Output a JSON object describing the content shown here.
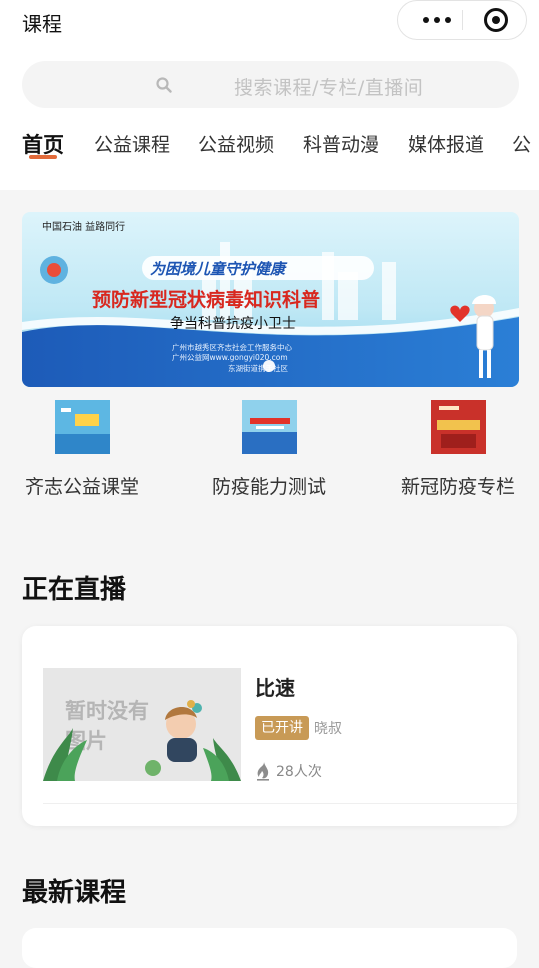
{
  "header": {
    "title": "课程"
  },
  "capsule": {
    "more_icon": "more-dots-icon",
    "close_icon": "target-circle-icon"
  },
  "search": {
    "placeholder": "搜索课程/专栏/直播间",
    "icon": "search-icon"
  },
  "tabs": [
    {
      "label": "首页",
      "active": true
    },
    {
      "label": "公益课程",
      "active": false
    },
    {
      "label": "公益视频",
      "active": false
    },
    {
      "label": "科普动漫",
      "active": false
    },
    {
      "label": "媒体报道",
      "active": false
    },
    {
      "label": "公",
      "active": false
    }
  ],
  "banner": {
    "logo_text": "中国石油 益路同行",
    "line1": "为困境儿童守护健康",
    "line2": "预防新型冠状病毒知识科普",
    "line3": "争当科普抗疫小卫士",
    "footer1": "广州市越秀区齐志社会工作服务中心",
    "footer2": "广州公益网www.gongyi020.com",
    "footer3": "东湖街道携手社区"
  },
  "shortcuts": [
    {
      "label": "齐志公益课堂"
    },
    {
      "label": "防疫能力测试"
    },
    {
      "label": "新冠防疫专栏"
    }
  ],
  "live": {
    "section_title": "正在直播",
    "item": {
      "name": "比速",
      "status": "已开讲",
      "lecturer": "晓叔",
      "views": "28人次",
      "thumb_placeholder": "暂时没有图片"
    }
  },
  "latest": {
    "section_title": "最新课程"
  },
  "colors": {
    "accent": "#e26a3a",
    "badge": "#c89a56",
    "background": "#f5f5f5"
  }
}
